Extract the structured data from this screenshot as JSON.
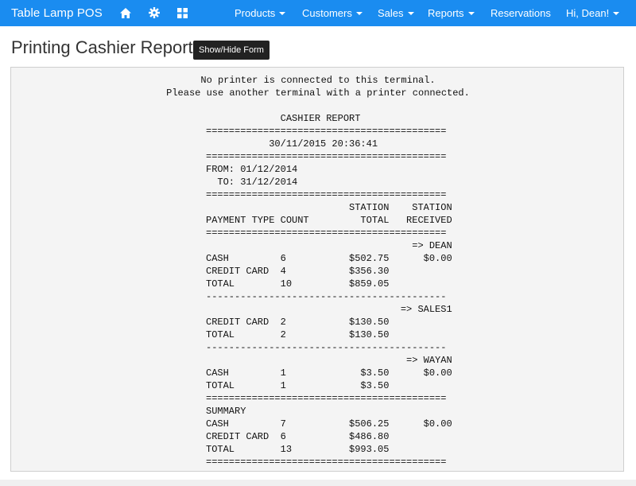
{
  "navbar": {
    "brand": "Table Lamp POS",
    "icons": [
      "home-icon",
      "gear-icon",
      "grid-icon"
    ],
    "items": [
      {
        "label": "Products",
        "dropdown": true
      },
      {
        "label": "Customers",
        "dropdown": true
      },
      {
        "label": "Sales",
        "dropdown": true
      },
      {
        "label": "Reports",
        "dropdown": true
      },
      {
        "label": "Reservations",
        "dropdown": false
      },
      {
        "label": "Hi, Dean!",
        "dropdown": true
      }
    ],
    "color": "#1a8cf0"
  },
  "page": {
    "title": "Printing Cashier Report",
    "toggle_button": "Show/Hide Form"
  },
  "report": {
    "notice_lines": [
      "No printer is connected to this terminal.",
      "Please use another terminal with a printer connected."
    ],
    "lines": [
      "",
      "             CASHIER REPORT",
      "==========================================",
      "           30/11/2015 20:36:41",
      "==========================================",
      "FROM: 01/12/2014",
      "  TO: 31/12/2014",
      "==========================================",
      "                         STATION    STATION",
      "PAYMENT TYPE COUNT         TOTAL   RECEIVED",
      "==========================================",
      "                                    => DEAN",
      "CASH         6           $502.75      $0.00",
      "CREDIT CARD  4           $356.30",
      "TOTAL        10          $859.05",
      "------------------------------------------",
      "                                  => SALES1",
      "CREDIT CARD  2           $130.50",
      "TOTAL        2           $130.50",
      "------------------------------------------",
      "                                   => WAYAN",
      "CASH         1             $3.50      $0.00",
      "TOTAL        1             $3.50",
      "==========================================",
      "SUMMARY",
      "CASH         7           $506.25      $0.00",
      "CREDIT CARD  6           $486.80",
      "TOTAL        13          $993.05",
      "=========================================="
    ]
  }
}
